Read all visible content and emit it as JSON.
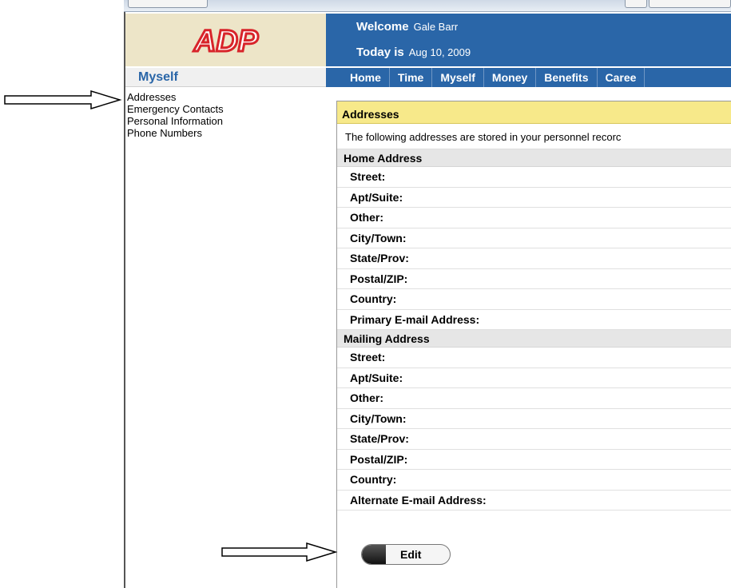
{
  "header": {
    "logo_text": "ADP",
    "welcome_label": "Welcome",
    "user_name": "Gale Barr",
    "today_label": "Today is",
    "today_date": "Aug 10, 2009"
  },
  "sidebar": {
    "title": "Myself",
    "items": [
      {
        "label": "Addresses"
      },
      {
        "label": "Emergency Contacts"
      },
      {
        "label": "Personal Information"
      },
      {
        "label": "Phone Numbers"
      }
    ]
  },
  "nav": {
    "items": [
      {
        "label": "Home"
      },
      {
        "label": "Time"
      },
      {
        "label": "Myself"
      },
      {
        "label": "Money"
      },
      {
        "label": "Benefits"
      },
      {
        "label": "Caree"
      }
    ]
  },
  "panel": {
    "title": "Addresses",
    "intro": "The following addresses are stored in your personnel recorc",
    "home": {
      "heading": "Home Address",
      "fields": [
        {
          "label": "Street:"
        },
        {
          "label": "Apt/Suite:"
        },
        {
          "label": "Other:"
        },
        {
          "label": "City/Town:"
        },
        {
          "label": "State/Prov:"
        },
        {
          "label": "Postal/ZIP:"
        },
        {
          "label": "Country:"
        },
        {
          "label": "Primary E-mail Address:"
        }
      ]
    },
    "mailing": {
      "heading": "Mailing Address",
      "fields": [
        {
          "label": "Street:"
        },
        {
          "label": "Apt/Suite:"
        },
        {
          "label": "Other:"
        },
        {
          "label": "City/Town:"
        },
        {
          "label": "State/Prov:"
        },
        {
          "label": "Postal/ZIP:"
        },
        {
          "label": "Country:"
        },
        {
          "label": "Alternate E-mail Address:"
        }
      ]
    },
    "edit_label": "Edit"
  },
  "colors": {
    "brand_blue": "#2a66a8",
    "logo_bg": "#ede5c8",
    "logo_red": "#d8242a",
    "panel_header_bg": "#f7e98a"
  }
}
